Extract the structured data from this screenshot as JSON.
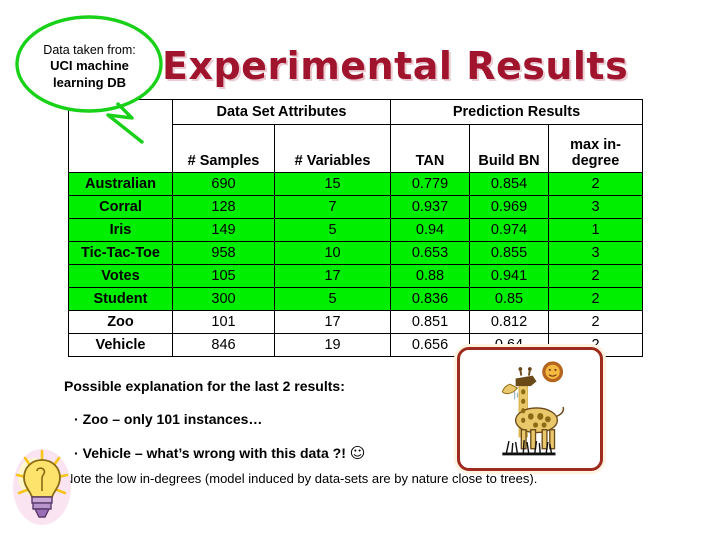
{
  "slide": {
    "title": "Experimental Results",
    "title_color": "#A0142E",
    "highlight_color": "#00ee00"
  },
  "callout": {
    "icon": "speech-bubble-icon",
    "outline_color": "#19d119",
    "line1": "Data taken from:",
    "line2": "UCI machine",
    "line3": "learning DB"
  },
  "table": {
    "corner_label": "",
    "group_headers": [
      {
        "label": "Data Set Attributes",
        "span": 2
      },
      {
        "label": "Prediction Results",
        "span": 3
      }
    ],
    "columns": [
      "",
      "# Samples",
      "# Variables",
      "TAN",
      "Build BN",
      "max in-degree"
    ],
    "rows": [
      {
        "name": "Australian",
        "samples": "690",
        "variables": "15",
        "tan": "0.779",
        "build_bn": "0.854",
        "max_in_degree": "2",
        "highlight": true
      },
      {
        "name": "Corral",
        "samples": "128",
        "variables": "7",
        "tan": "0.937",
        "build_bn": "0.969",
        "max_in_degree": "3",
        "highlight": true
      },
      {
        "name": "Iris",
        "samples": "149",
        "variables": "5",
        "tan": "0.94",
        "build_bn": "0.974",
        "max_in_degree": "1",
        "highlight": true
      },
      {
        "name": "Tic-Tac-Toe",
        "samples": "958",
        "variables": "10",
        "tan": "0.653",
        "build_bn": "0.855",
        "max_in_degree": "3",
        "highlight": true
      },
      {
        "name": "Votes",
        "samples": "105",
        "variables": "17",
        "tan": "0.88",
        "build_bn": "0.941",
        "max_in_degree": "2",
        "highlight": true
      },
      {
        "name": "Student",
        "samples": "300",
        "variables": "5",
        "tan": "0.836",
        "build_bn": "0.85",
        "max_in_degree": "2",
        "highlight": true
      },
      {
        "name": "Zoo",
        "samples": "101",
        "variables": "17",
        "tan": "0.851",
        "build_bn": "0.812",
        "max_in_degree": "2",
        "highlight": false
      },
      {
        "name": "Vehicle",
        "samples": "846",
        "variables": "19",
        "tan": "0.656",
        "build_bn": "0.64",
        "max_in_degree": "2",
        "highlight": false
      }
    ]
  },
  "notes": {
    "heading": "Possible explanation for the last 2 results:",
    "bullet_char": "·",
    "bullet1": "Zoo – only 101 instances…",
    "bullet2": "Vehicle – what’s wrong with this data ?!",
    "bullet2_emoji": "☺",
    "closing": "Note the low in-degrees (model induced by data-sets are by nature close to trees)."
  },
  "clipart": {
    "lightbulb": "lightbulb-icon",
    "giraffe": "giraffe-illustration"
  }
}
